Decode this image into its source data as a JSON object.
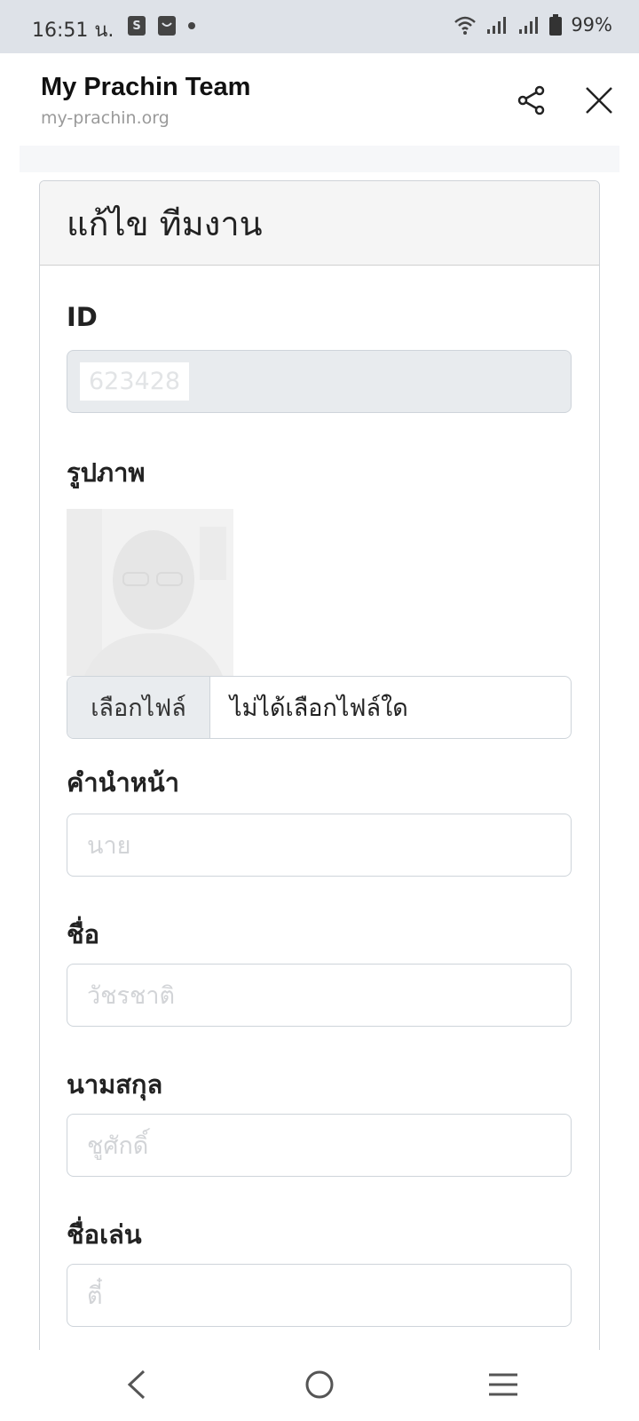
{
  "status_bar": {
    "time": "16:51 น.",
    "battery": "99%",
    "icons": [
      "shop-icon",
      "bag-icon",
      "dot-icon",
      "wifi-icon",
      "signal-icon",
      "signal-icon",
      "battery-icon"
    ]
  },
  "browser": {
    "title": "My Prachin Team",
    "url": "my-prachin.org",
    "icons": [
      "share-icon",
      "close-icon"
    ]
  },
  "card": {
    "title": "แก้ไข ทีมงาน"
  },
  "form": {
    "id_label": "ID",
    "id_value": "623428",
    "photo_label": "รูปภาพ",
    "file_button": "เลือกไฟล์",
    "file_status": "ไม่ได้เลือกไฟล์ใด",
    "prefix_label": "คำนำหน้า",
    "prefix_placeholder": "นาย",
    "firstname_label": "ชื่อ",
    "firstname_placeholder": "วัชรชาติ",
    "lastname_label": "นามสกุล",
    "lastname_placeholder": "ชูศักดิ์",
    "nickname_label": "ชื่อเล่น",
    "nickname_placeholder": "ตี๋"
  },
  "nav": {
    "icons": [
      "back-icon",
      "home-icon",
      "menu-icon"
    ]
  }
}
